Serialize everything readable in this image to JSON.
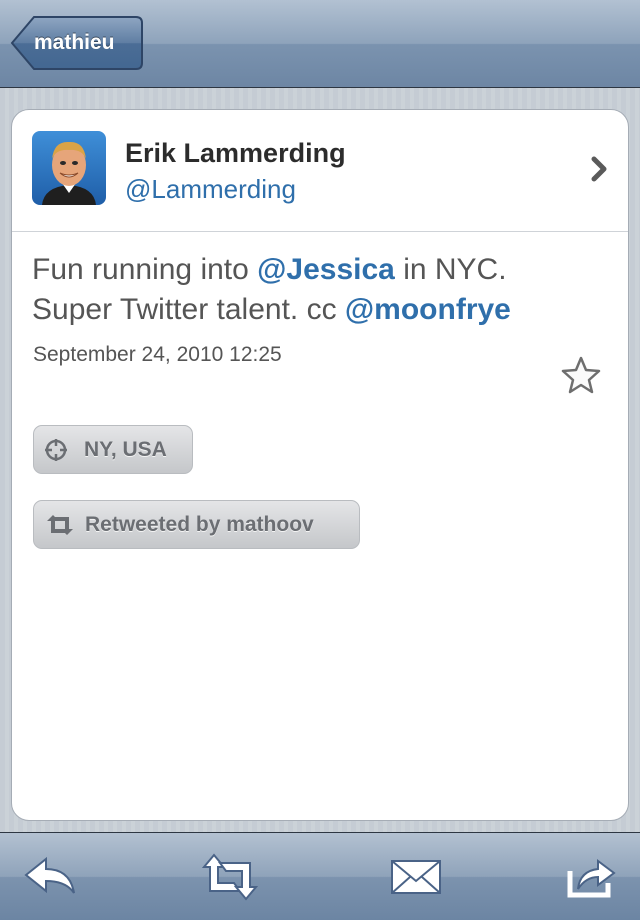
{
  "navbar": {
    "back_label": "mathieu"
  },
  "tweet": {
    "author_name": "Erik Lammerding",
    "author_handle": "@Lammerding",
    "text_part1": "Fun running into ",
    "mention1": "@Jessica",
    "text_part2": " in NYC. Super Twitter talent. cc ",
    "mention2": "@moonfrye",
    "timestamp": "September 24, 2010 12:25",
    "location": "NY, USA",
    "retweeted_by": "Retweeted by mathoov"
  },
  "toolbar": {
    "icons": [
      "reply-icon",
      "retweet-icon",
      "mail-icon",
      "share-icon"
    ]
  },
  "colors": {
    "link": "#2f6fab",
    "navbar": "#7b93af",
    "card_bg": "#ffffff"
  }
}
